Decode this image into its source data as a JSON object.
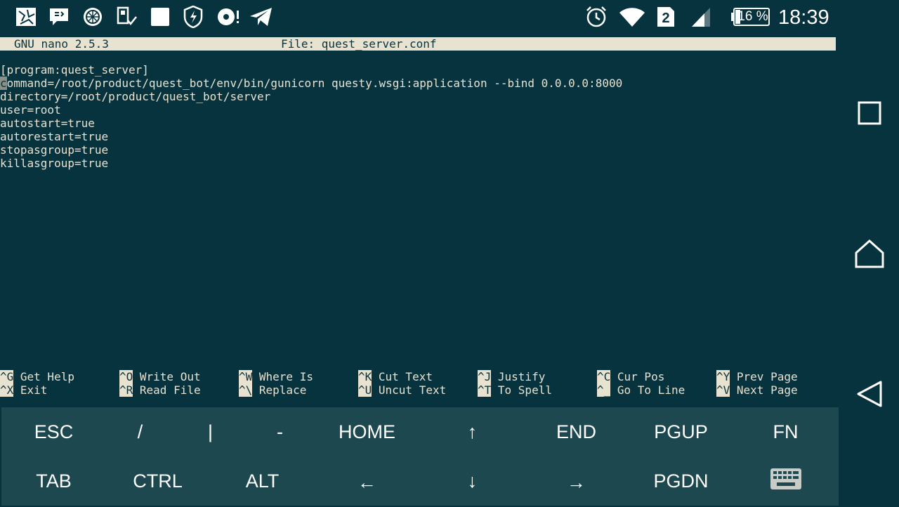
{
  "status_bar": {
    "icons": [
      "gallery-icon",
      "chat-icon",
      "orange-icon",
      "usb-icon",
      "square-notification-icon",
      "shield-bolt-icon",
      "disc-icon",
      "telegram-icon"
    ],
    "system_icons": [
      "alarm-icon",
      "wifi-icon",
      "sim-2-icon",
      "signal-icon",
      "battery-icon"
    ],
    "sim_label": "2",
    "battery": "16 %",
    "time": "18:39"
  },
  "nano": {
    "version": "GNU nano 2.5.3",
    "file": "File: quest_server.conf",
    "cursor_char": "c",
    "first_line_rest": "ommand=/root/product/quest_bot/env/bin/gunicorn questy.wsgi:application --bind 0.0.0.0:8000",
    "lines": [
      "[program:quest_server]",
      "command=/root/product/quest_bot/env/bin/gunicorn questy.wsgi:application --bind 0.0.0.0:8000",
      "directory=/root/product/quest_bot/server",
      "user=root",
      "autostart=true",
      "autorestart=true",
      "stopasgroup=true",
      "killasgroup=true"
    ]
  },
  "shortcuts": [
    {
      "key": "^G",
      "label": " Get Help"
    },
    {
      "key": "^X",
      "label": " Exit"
    },
    {
      "key": "^O",
      "label": " Write Out"
    },
    {
      "key": "^R",
      "label": " Read File"
    },
    {
      "key": "^W",
      "label": " Where Is"
    },
    {
      "key": "^\\",
      "label": " Replace"
    },
    {
      "key": "^K",
      "label": " Cut Text"
    },
    {
      "key": "^U",
      "label": " Uncut Text"
    },
    {
      "key": "^J",
      "label": " Justify"
    },
    {
      "key": "^T",
      "label": " To Spell"
    },
    {
      "key": "^C",
      "label": " Cur Pos"
    },
    {
      "key": "^_",
      "label": " Go To Line"
    },
    {
      "key": "^Y",
      "label": " Prev Page"
    },
    {
      "key": "^V",
      "label": " Next Page"
    }
  ],
  "extra_keys": {
    "row1": [
      "ESC",
      "/",
      "|",
      "-",
      "HOME",
      "↑",
      "END",
      "PGUP",
      "FN"
    ],
    "row2": [
      "TAB",
      "CTRL",
      "ALT",
      "←",
      "↓",
      "→",
      "PGDN"
    ],
    "keyboard_icon": "keyboard-icon"
  },
  "nav_bar": [
    "recents-icon",
    "home-icon",
    "back-icon"
  ]
}
